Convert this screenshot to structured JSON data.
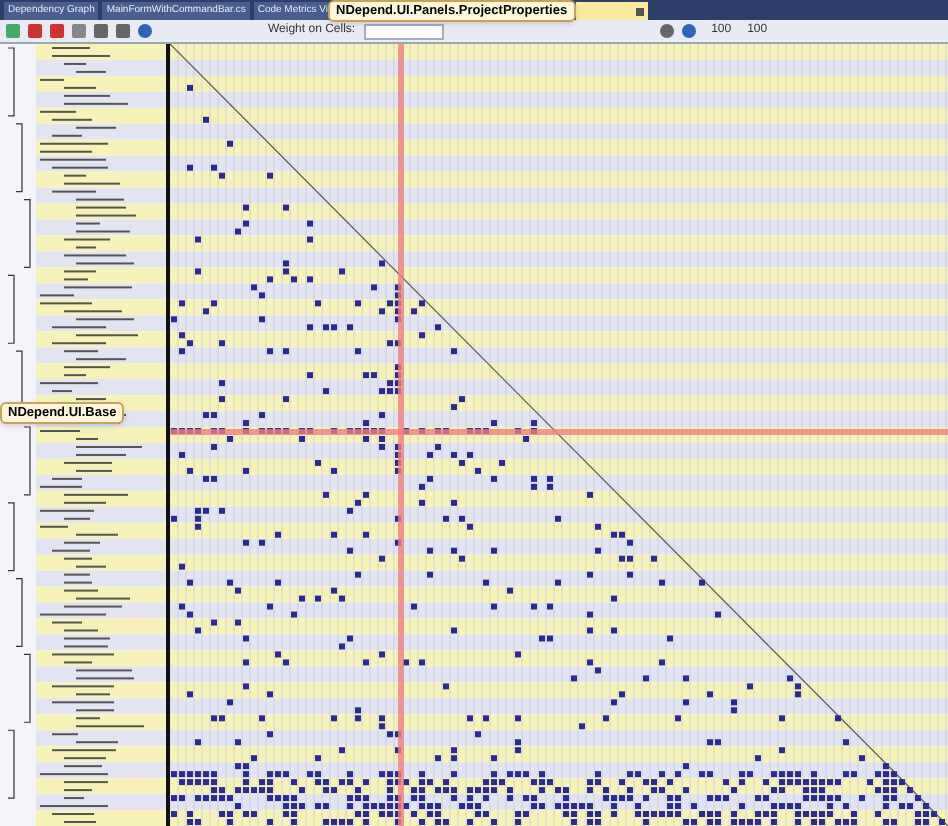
{
  "tabs": [
    {
      "label": "Dependency Graph",
      "selected": false
    },
    {
      "label": "MainFormWithCommandBar.cs",
      "selected": false
    },
    {
      "label": "Code Metrics Vi",
      "selected": false
    }
  ],
  "toolbar": {
    "weight_label": "Weight on Cells:",
    "zoom_values": [
      "100",
      "100"
    ]
  },
  "tooltips": [
    {
      "text": "NDepend.UI.Panels.ProjectProperties",
      "kind": "column"
    },
    {
      "text": "NDepend.UI.Base",
      "kind": "row"
    }
  ]
}
